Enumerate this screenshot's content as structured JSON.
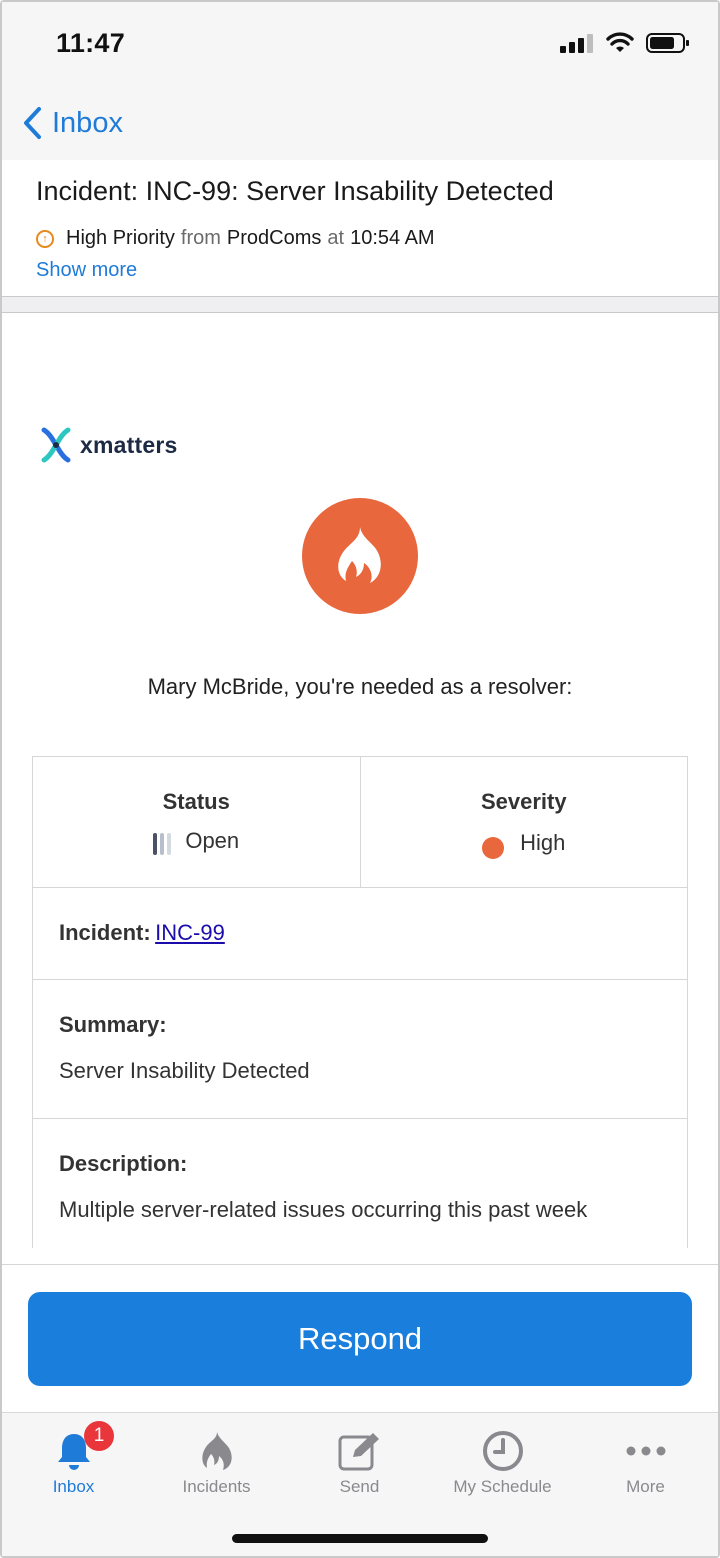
{
  "status_bar": {
    "time": "11:47"
  },
  "nav": {
    "back_label": "Inbox"
  },
  "message": {
    "title": "Incident: INC-99: Server Insability Detected",
    "priority": "High Priority",
    "from_word": "from",
    "sender": "ProdComs",
    "at_word": "at",
    "time": "10:54 AM",
    "show_more": "Show more"
  },
  "email": {
    "logo_text": "xmatters",
    "greeting": "Mary McBride, you're needed as a resolver:",
    "status_label": "Status",
    "status_value": "Open",
    "severity_label": "Severity",
    "severity_value": "High",
    "incident_label": "Incident:",
    "incident_link": "INC-99",
    "summary_label": "Summary:",
    "summary_value": "Server Insability Detected",
    "description_label": "Description:",
    "description_value": "Multiple server-related issues occurring this past week"
  },
  "actions": {
    "respond": "Respond"
  },
  "tabbar": {
    "items": [
      {
        "label": "Inbox",
        "icon": "bell-icon",
        "badge": "1",
        "active": true
      },
      {
        "label": "Incidents",
        "icon": "flame-icon"
      },
      {
        "label": "Send",
        "icon": "compose-icon"
      },
      {
        "label": "My Schedule",
        "icon": "clock-icon"
      },
      {
        "label": "More",
        "icon": "more-icon"
      }
    ]
  },
  "colors": {
    "accent": "#1f7bd8",
    "button": "#1a7fdc",
    "flame": "#e8673c",
    "priority": "#e8891c",
    "badge": "#e8363a"
  }
}
